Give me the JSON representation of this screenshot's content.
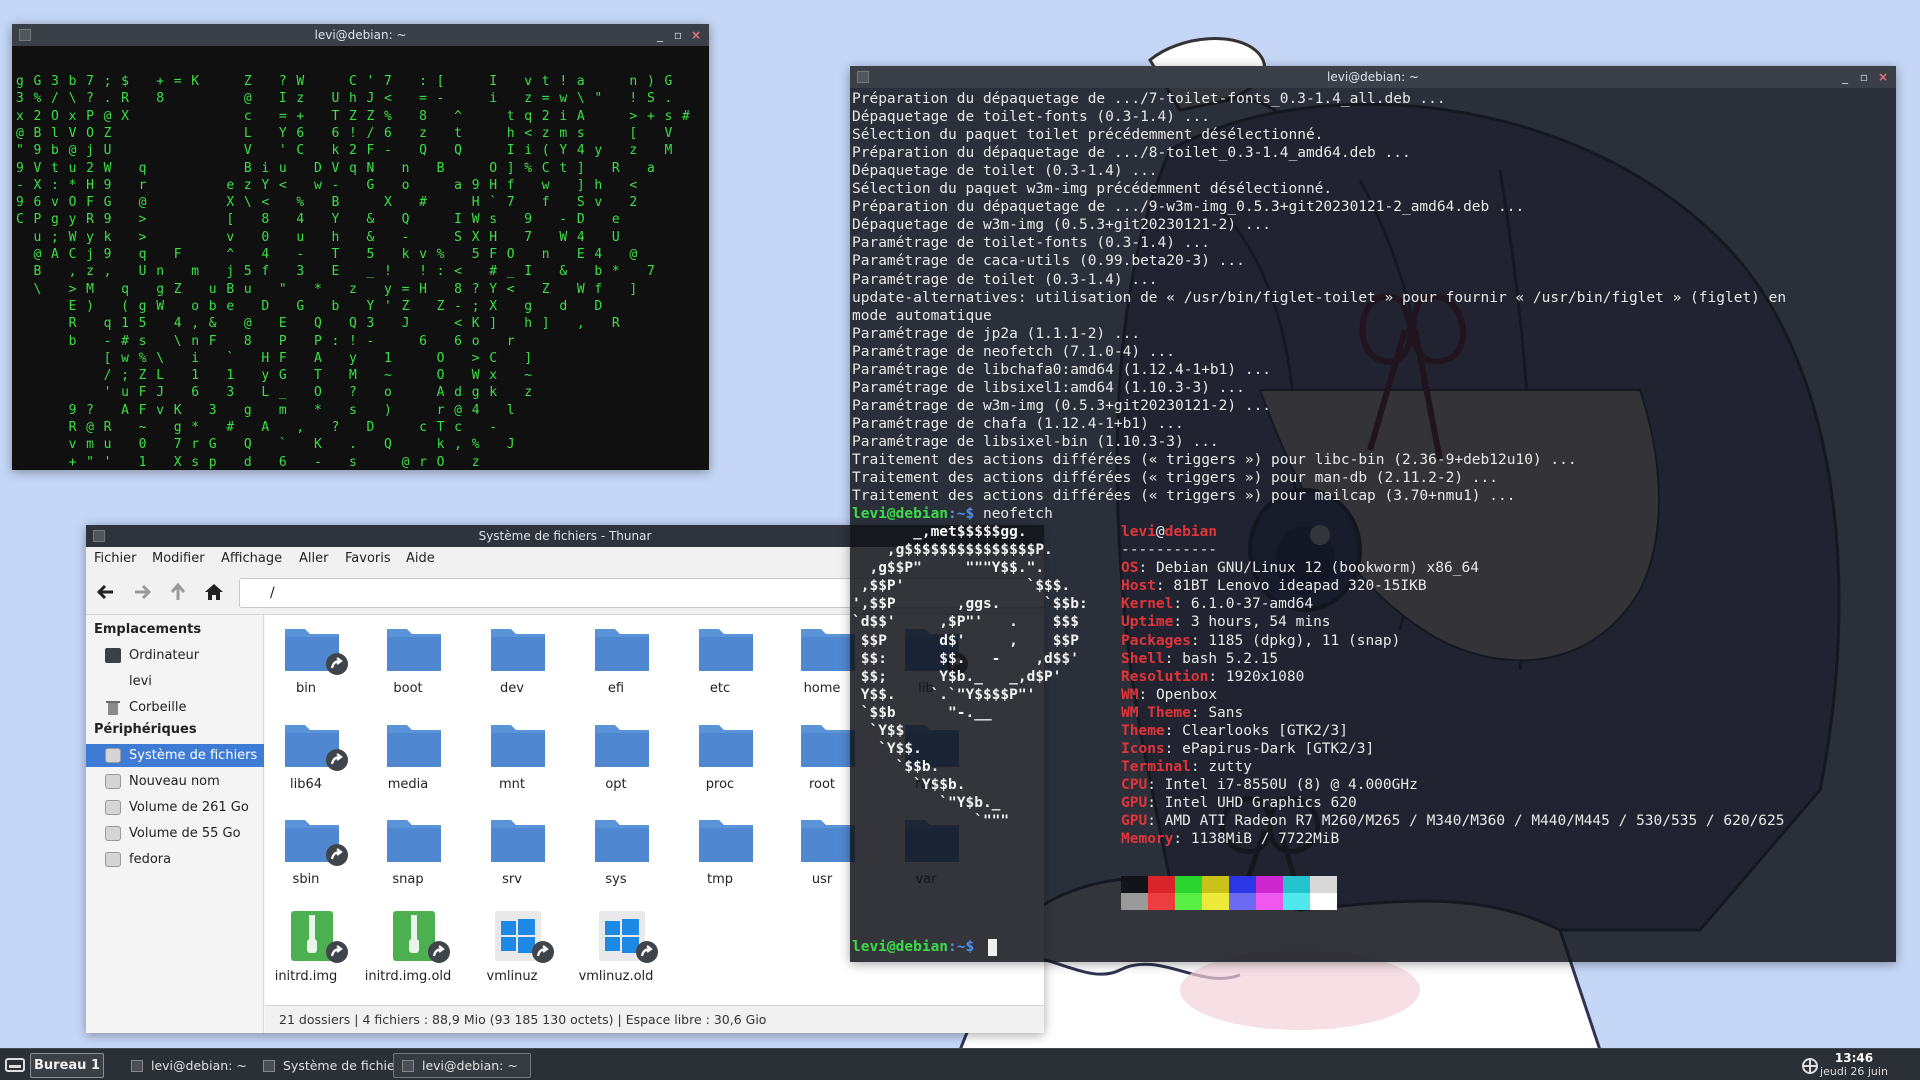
{
  "desktop": {
    "background": "#c5d6f6"
  },
  "matrix_terminal": {
    "title": "levi@debian: ~",
    "glyph_color": "#3ddf46",
    "rows": [
      "gG3b7;$ +=K  Z ?W  C'7 :[  I vt!a  n)G",
      "3%/\\?.R 8    @ Iz UhJ< =-  i z=w\\\" !S.",
      "x2OxP@X      c =+ TZZ% 8 ^  tq2iA  >+s#",
      "@BlVOZ       L Y6 6!/6 z t  h<zms  [ V",
      "\"9b@jU       V 'C k2F- Q Q  Ii(Y4y z M",
      "9Vtu2W q     Biu DVqN n B  O]%Ct] R a",
      "-X:*H9 r    ezY< w- G o  a9Hf w ]h <",
      "96vOFG @    X\\< % B  X #  H`7 f Sv 2",
      "CPgyR9 >    [ 8 4 Y & Q  IWs 9 -D e",
      " u;Wyk >    v 0 u h & -  SXH 7 W4 U",
      " @ACj9 q F  ^ 4 - T 5 kv% 5FO n E4 @",
      " B ,z, Un m j5f 3 E _! !:< #_I & b* 7",
      " \\ >M q gZ uBu \" * z y=H 8?Y< Z Wf ]",
      "   E) (gW obe D G b Y'Z Z-;X g d D",
      "   R q15 4,& @ E Q Q3 J  <K] h] , R",
      "   b -#s \\nF 8 P P:!-  6 6o r",
      "     [w%\\ i ` HF A y 1  O >C ]",
      "     /;ZL 1 1 yG T M ~  O Wx ~",
      "     'uFJ 6 3 L_ O ? o  Adgk z",
      "   9? AFvK 3 g m * s )  r@4 l",
      "   R@R ~ g* # A , ? D  cTc -",
      "   vmu 0 7rG Q ` K . Q  k,% J",
      "   +\"' 1 Xsp d 6 - s  @rO z"
    ]
  },
  "thunar": {
    "title": "Système de fichiers - Thunar",
    "menu": [
      "Fichier",
      "Modifier",
      "Affichage",
      "Aller",
      "Favoris",
      "Aide"
    ],
    "location": "/",
    "sidebar": {
      "places_header": "Emplacements",
      "places": [
        "Ordinateur",
        "levi",
        "Corbeille"
      ],
      "devices_header": "Périphériques",
      "devices": [
        "Système de fichiers",
        "Nouveau nom",
        "Volume de 261 Go",
        "Volume de 55 Go",
        "fedora"
      ],
      "selected": "Système de fichiers"
    },
    "files": [
      {
        "name": "bin",
        "kind": "folder",
        "link": true
      },
      {
        "name": "boot",
        "kind": "folder",
        "link": false
      },
      {
        "name": "dev",
        "kind": "folder",
        "link": false
      },
      {
        "name": "efi",
        "kind": "folder",
        "link": false
      },
      {
        "name": "etc",
        "kind": "folder",
        "link": false
      },
      {
        "name": "home",
        "kind": "folder",
        "link": false
      },
      {
        "name": "lib",
        "kind": "folder",
        "link": true
      },
      {
        "name": "lib64",
        "kind": "folder",
        "link": true
      },
      {
        "name": "media",
        "kind": "folder",
        "link": false
      },
      {
        "name": "mnt",
        "kind": "folder",
        "link": false
      },
      {
        "name": "opt",
        "kind": "folder",
        "link": false
      },
      {
        "name": "proc",
        "kind": "folder",
        "link": false
      },
      {
        "name": "root",
        "kind": "folder",
        "link": false
      },
      {
        "name": "run",
        "kind": "folder",
        "link": false
      },
      {
        "name": "sbin",
        "kind": "folder",
        "link": true
      },
      {
        "name": "snap",
        "kind": "folder",
        "link": false
      },
      {
        "name": "srv",
        "kind": "folder",
        "link": false
      },
      {
        "name": "sys",
        "kind": "folder",
        "link": false
      },
      {
        "name": "tmp",
        "kind": "folder",
        "link": false
      },
      {
        "name": "usr",
        "kind": "folder",
        "link": false
      },
      {
        "name": "var",
        "kind": "folder",
        "link": false
      },
      {
        "name": "initrd.img",
        "kind": "archive",
        "link": true
      },
      {
        "name": "initrd.img.old",
        "kind": "archive",
        "link": true
      },
      {
        "name": "vmlinuz",
        "kind": "windows",
        "link": true
      },
      {
        "name": "vmlinuz.old",
        "kind": "windows",
        "link": true
      }
    ],
    "status": "21 dossiers  |  4 fichiers : 88,9 Mio (93 185 130 octets)  |  Espace libre : 30,6 Gio",
    "folder_color": "#5b93d8"
  },
  "terminal": {
    "title": "levi@debian: ~",
    "apt_lines": [
      "Préparation du dépaquetage de .../7-toilet-fonts_0.3-1.4_all.deb ...",
      "Dépaquetage de toilet-fonts (0.3-1.4) ...",
      "Sélection du paquet toilet précédemment désélectionné.",
      "Préparation du dépaquetage de .../8-toilet_0.3-1.4_amd64.deb ...",
      "Dépaquetage de toilet (0.3-1.4) ...",
      "Sélection du paquet w3m-img précédemment désélectionné.",
      "Préparation du dépaquetage de .../9-w3m-img_0.5.3+git20230121-2_amd64.deb ...",
      "Dépaquetage de w3m-img (0.5.3+git20230121-2) ...",
      "Paramétrage de toilet-fonts (0.3-1.4) ...",
      "Paramétrage de caca-utils (0.99.beta20-3) ...",
      "Paramétrage de toilet (0.3-1.4) ...",
      "update-alternatives: utilisation de « /usr/bin/figlet-toilet » pour fournir « /usr/bin/figlet » (figlet) en",
      "mode automatique",
      "Paramétrage de jp2a (1.1.1-2) ...",
      "Paramétrage de neofetch (7.1.0-4) ...",
      "Paramétrage de libchafa0:amd64 (1.12.4-1+b1) ...",
      "Paramétrage de libsixel1:amd64 (1.10.3-3) ...",
      "Paramétrage de w3m-img (0.5.3+git20230121-2) ...",
      "Paramétrage de chafa (1.12.4-1+b1) ...",
      "Paramétrage de libsixel-bin (1.10.3-3) ...",
      "Traitement des actions différées (« triggers ») pour libc-bin (2.36-9+deb12u10) ...",
      "Traitement des actions différées (« triggers ») pour man-db (2.11.2-2) ...",
      "Traitement des actions différées (« triggers ») pour mailcap (3.70+nmu1) ..."
    ],
    "prompt_user": "levi@debian",
    "prompt_path": ":~$",
    "command": " neofetch",
    "ascii": [
      "       _,met$$$$$gg.",
      "    ,g$$$$$$$$$$$$$$$P.",
      "  ,g$$P\"     \"\"\"Y$$.\".",
      " ,$$P'              `$$$.",
      "',$$P       ,ggs.     `$$b:",
      "`d$$'     ,$P\"'   .    $$$",
      " $$P      d$'     ,    $$P",
      " $$:      $$.   -    ,d$$'",
      " $$;      Y$b._   _,d$P'",
      " Y$$.    `.`\"Y$$$$P\"'",
      " `$$b      \"-.__",
      "  `Y$$",
      "   `Y$$.",
      "     `$$b.",
      "       `Y$$b.",
      "          `\"Y$b._",
      "              `\"\"\""
    ],
    "neofetch": {
      "user": "levi",
      "at": "@",
      "host": "debian",
      "separator": "-----------",
      "fields": [
        {
          "key": "OS",
          "value": "Debian GNU/Linux 12 (bookworm) x86_64"
        },
        {
          "key": "Host",
          "value": "81BT Lenovo ideapad 320-15IKB"
        },
        {
          "key": "Kernel",
          "value": "6.1.0-37-amd64"
        },
        {
          "key": "Uptime",
          "value": "3 hours, 54 mins"
        },
        {
          "key": "Packages",
          "value": "1185 (dpkg), 11 (snap)"
        },
        {
          "key": "Shell",
          "value": "bash 5.2.15"
        },
        {
          "key": "Resolution",
          "value": "1920x1080"
        },
        {
          "key": "WM",
          "value": "Openbox"
        },
        {
          "key": "WM Theme",
          "value": "Sans"
        },
        {
          "key": "Theme",
          "value": "Clearlooks [GTK2/3]"
        },
        {
          "key": "Icons",
          "value": "ePapirus-Dark [GTK2/3]"
        },
        {
          "key": "Terminal",
          "value": "zutty"
        },
        {
          "key": "CPU",
          "value": "Intel i7-8550U (8) @ 4.000GHz"
        },
        {
          "key": "GPU",
          "value": "Intel UHD Graphics 620"
        },
        {
          "key": "GPU",
          "value": "AMD ATI Radeon R7 M260/M265 / M340/M360 / M440/M445 / 530/535 / 620/625"
        },
        {
          "key": "Memory",
          "value": "1138MiB / 7722MiB"
        }
      ],
      "palette_top": [
        "#12141a",
        "#d9242b",
        "#2bd52f",
        "#c9c218",
        "#2b37e6",
        "#cf27cf",
        "#23c2cc",
        "#d8d8d8"
      ],
      "palette_bottom": [
        "#9a9a9a",
        "#ee3d40",
        "#58ee46",
        "#ecea38",
        "#6b6bf2",
        "#ee58ee",
        "#4ee8ee",
        "#ffffff"
      ]
    }
  },
  "taskbar": {
    "desktop_label": "Bureau 1",
    "tasks": [
      {
        "label": "levi@debian: ~",
        "active": false
      },
      {
        "label": "Système de fichie...",
        "active": false
      },
      {
        "label": "levi@debian: ~",
        "active": true
      }
    ],
    "time": "13:46",
    "date": "jeudi 26 juin"
  }
}
